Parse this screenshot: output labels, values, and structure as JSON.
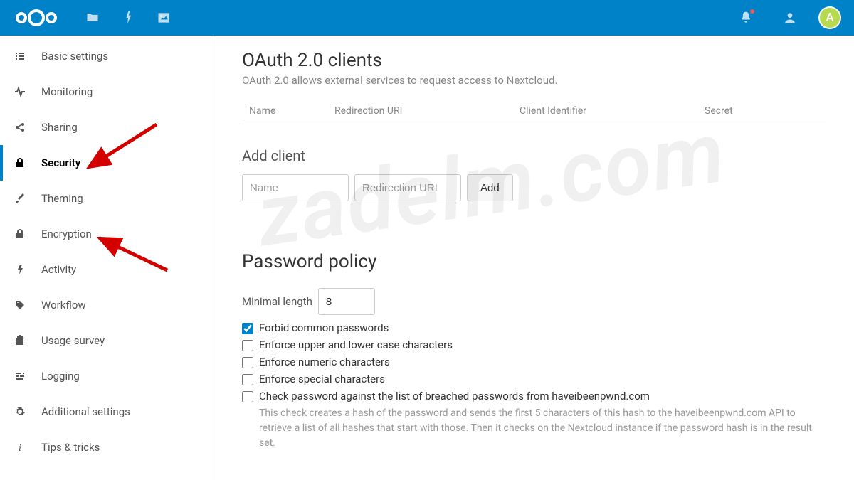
{
  "header": {
    "avatar_letter": "A"
  },
  "sidebar": {
    "items": [
      {
        "label": "Basic settings"
      },
      {
        "label": "Monitoring"
      },
      {
        "label": "Sharing"
      },
      {
        "label": "Security"
      },
      {
        "label": "Theming"
      },
      {
        "label": "Encryption"
      },
      {
        "label": "Activity"
      },
      {
        "label": "Workflow"
      },
      {
        "label": "Usage survey"
      },
      {
        "label": "Logging"
      },
      {
        "label": "Additional settings"
      },
      {
        "label": "Tips & tricks"
      }
    ]
  },
  "oauth": {
    "title": "OAuth 2.0 clients",
    "subtitle": "OAuth 2.0 allows external services to request access to Nextcloud.",
    "columns": {
      "name": "Name",
      "uri": "Redirection URI",
      "id": "Client Identifier",
      "secret": "Secret"
    },
    "add_title": "Add client",
    "name_placeholder": "Name",
    "uri_placeholder": "Redirection URI",
    "add_button": "Add"
  },
  "password_policy": {
    "title": "Password policy",
    "min_label": "Minimal length",
    "min_value": "8",
    "forbid_common": "Forbid common passwords",
    "enforce_case": "Enforce upper and lower case characters",
    "enforce_numeric": "Enforce numeric characters",
    "enforce_special": "Enforce special characters",
    "check_breach": "Check password against the list of breached passwords from haveibeenpwnd.com",
    "check_hint": "This check creates a hash of the password and sends the first 5 characters of this hash to the haveibeenpwnd.com API to retrieve a list of all hashes that start with those. Then it checks on the Nextcloud instance if the password hash is in the result set."
  },
  "watermark": "zadelm.com"
}
